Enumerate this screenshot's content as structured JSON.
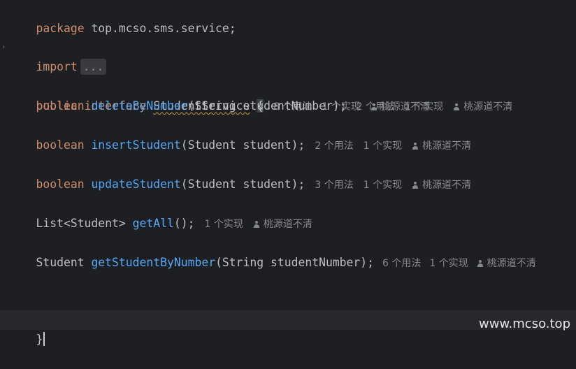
{
  "code": {
    "package_kw": "package",
    "package_name": "top.mcso.sms.service;",
    "import_kw": "import",
    "import_fold": "...",
    "public_kw": "public",
    "interface_kw": "interface",
    "interface_name": "StudentService",
    "open_brace": "{",
    "close_brace": "}",
    "methods": [
      {
        "return_type": "boolean",
        "name": "deleteByNumber",
        "params": "(String studentNumber);",
        "usages": "2 个用法",
        "impls": "1 个实现",
        "author": "桃源道不清"
      },
      {
        "return_type": "boolean",
        "name": "insertStudent",
        "params": "(Student student);",
        "usages": "2 个用法",
        "impls": "1 个实现",
        "author": "桃源道不清"
      },
      {
        "return_type": "boolean",
        "name": "updateStudent",
        "params": "(Student student);",
        "usages": "3 个用法",
        "impls": "1 个实现",
        "author": "桃源道不清"
      },
      {
        "return_type": "List<Student>",
        "name": "getAll",
        "params": "();",
        "usages": "",
        "impls": "1 个实现",
        "author": "桃源道不清"
      },
      {
        "return_type": "Student",
        "name": "getStudentByNumber",
        "params": "(String studentNumber);",
        "usages": "6 个用法",
        "impls": "1 个实现",
        "author": "桃源道不清"
      }
    ]
  },
  "interface_hints": {
    "usages": "8 个用法",
    "impls": "1 个实现",
    "author": "桃源道不清"
  },
  "watermark": "www.mcso.top",
  "colors": {
    "background": "#1e1f22",
    "keyword": "#cf8e6d",
    "method": "#56a8f5",
    "text": "#bcbec4",
    "hint": "#868a91"
  }
}
